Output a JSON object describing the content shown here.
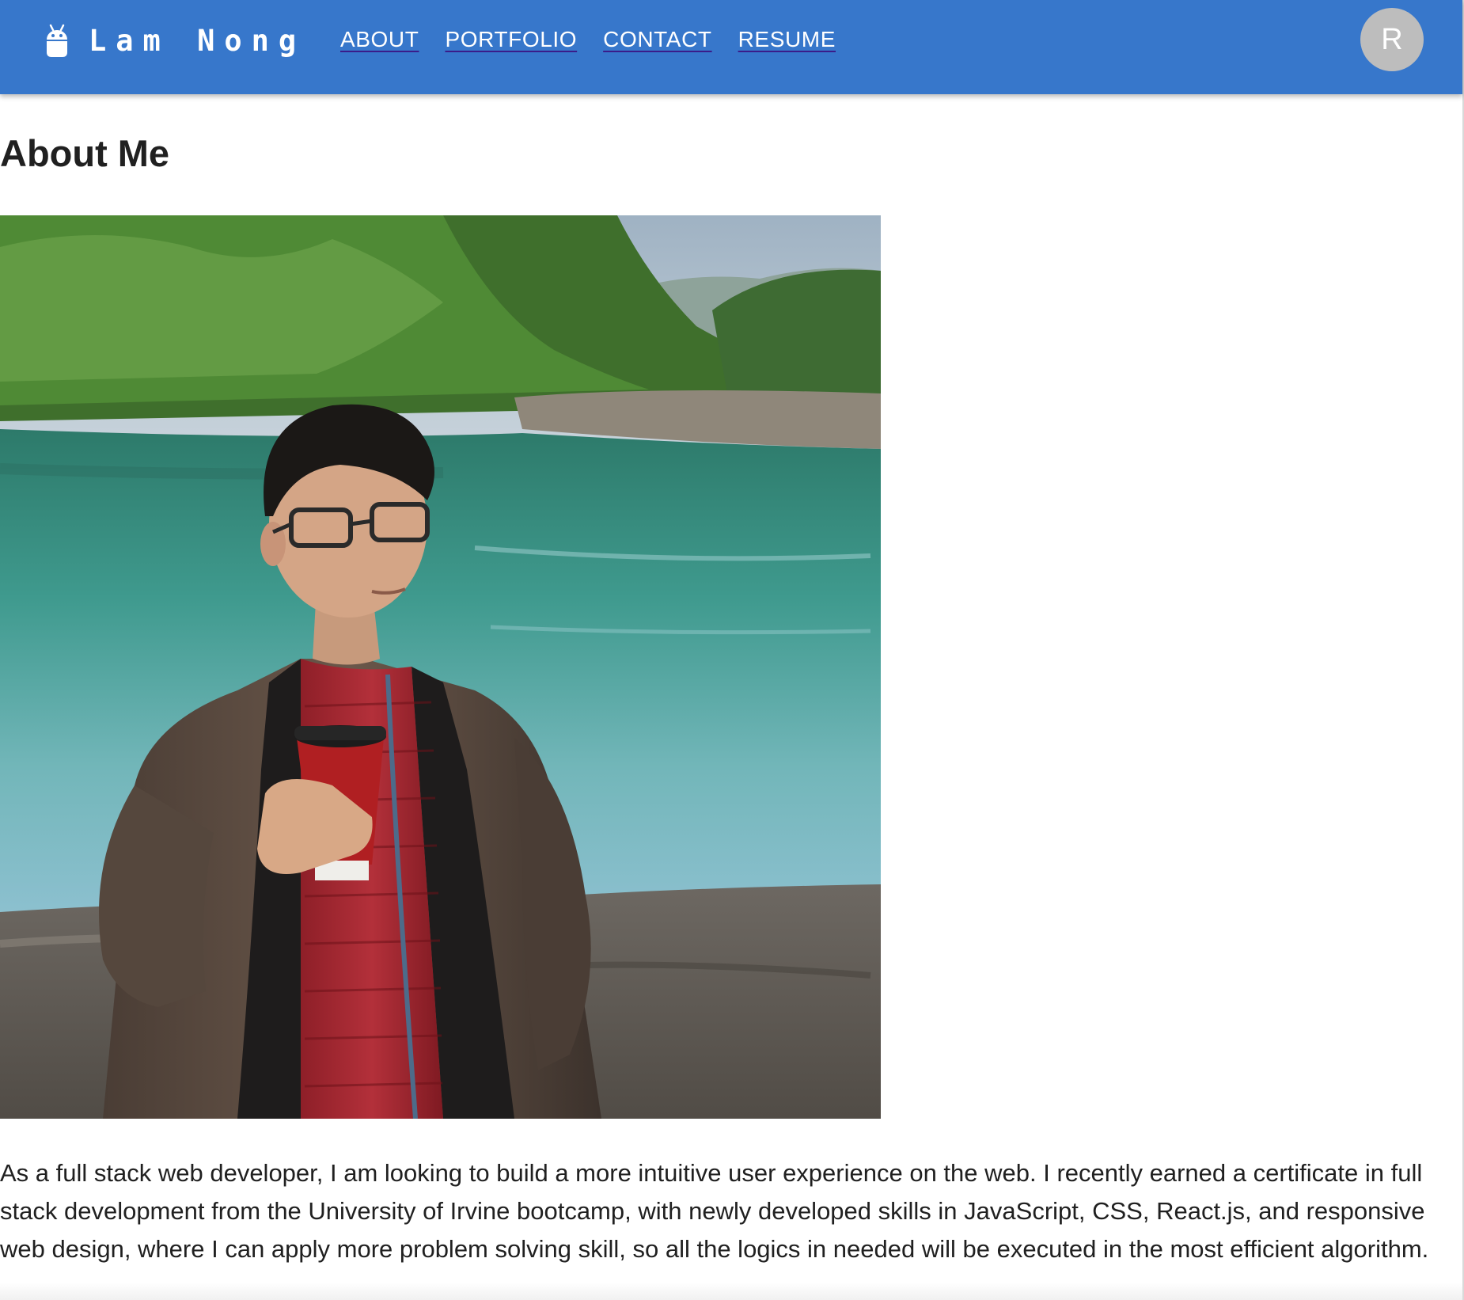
{
  "header": {
    "brand": "Lam Nong",
    "logo_icon": "android-icon",
    "nav": [
      {
        "label": "ABOUT"
      },
      {
        "label": "PORTFOLIO"
      },
      {
        "label": "CONTACT"
      },
      {
        "label": "RESUME"
      }
    ],
    "avatar_initial": "R",
    "colors": {
      "appbar": "#3777cb",
      "avatar": "#bdbdbd"
    }
  },
  "main": {
    "title": "About Me",
    "photo": "profile-photo",
    "bio": "As a full stack web developer, I am looking to build a more intuitive user experience on the web. I recently earned a certificate in full stack development from the University of Irvine bootcamp, with newly developed skills in JavaScript, CSS, React.js, and responsive web design, where I can apply more problem solving skill, so all the logics in needed will be executed in the most efficient algorithm."
  }
}
